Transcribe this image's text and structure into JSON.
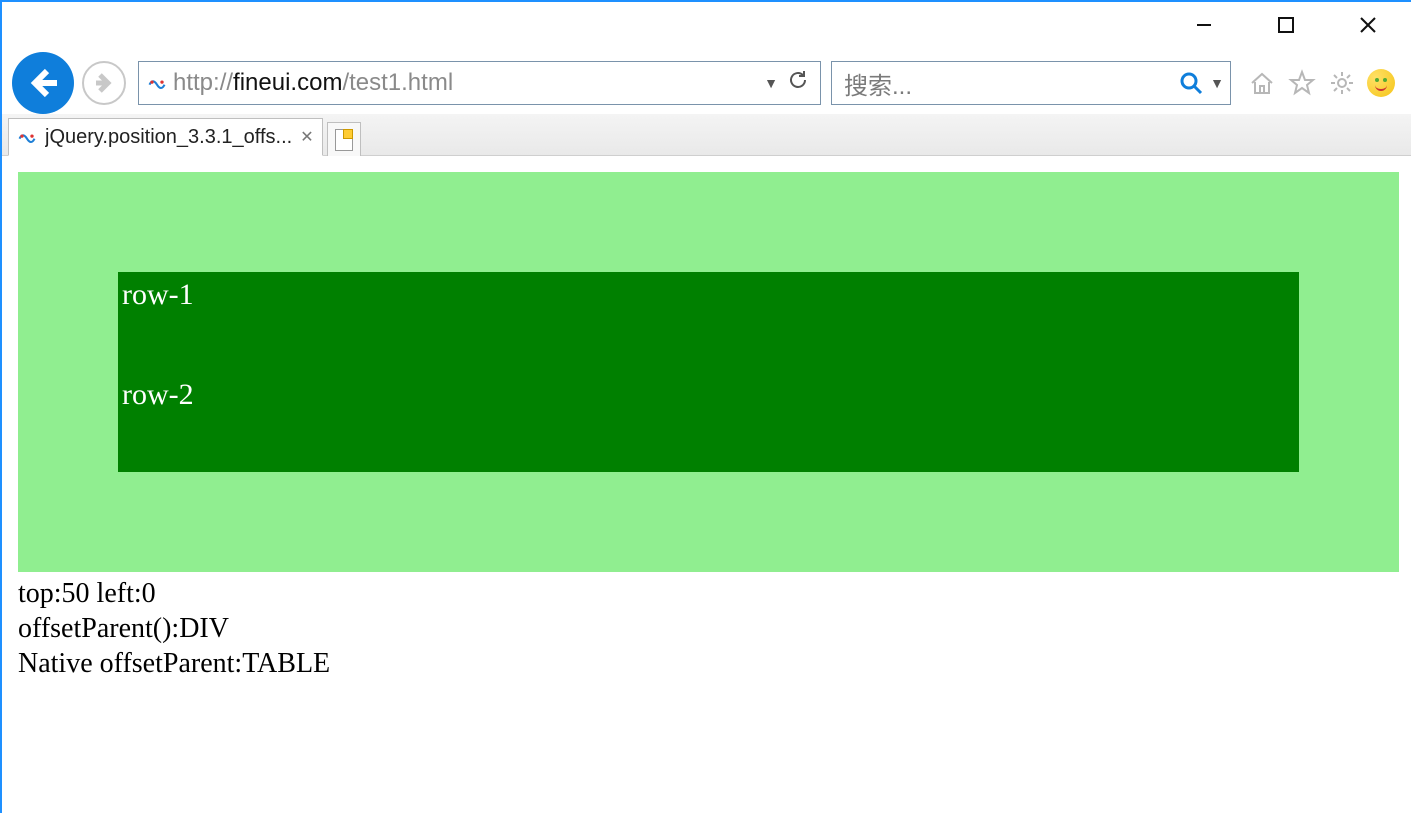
{
  "window": {
    "url_protocol": "http://",
    "url_host": "fineui.com",
    "url_path": "/test1.html",
    "search_placeholder": "搜索..."
  },
  "tab": {
    "title": "jQuery.position_3.3.1_offs..."
  },
  "page": {
    "rows": [
      "row-1",
      "row-2"
    ],
    "out_line1": "top:50 left:0",
    "out_line2": "offsetParent():DIV",
    "out_line3": "Native offsetParent:TABLE"
  }
}
